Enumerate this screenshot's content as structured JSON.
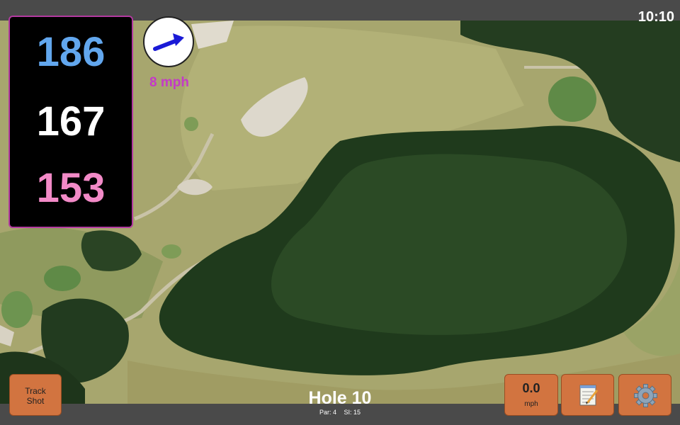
{
  "clock": "10:10",
  "distances": {
    "back": "186",
    "middle": "167",
    "front": "153"
  },
  "wind": {
    "speed": "8 mph",
    "icon": "arrow-right-icon"
  },
  "hole": {
    "title": "Hole 10",
    "par": "Par: 4",
    "si": "SI: 15"
  },
  "buttons": {
    "track_line1": "Track",
    "track_line2": "Shot",
    "speed_value": "0.0",
    "speed_unit": "mph",
    "notes_icon": "notepad-icon",
    "settings_icon": "gear-icon"
  },
  "colors": {
    "back": "#62a7ee",
    "middle": "#ffffff",
    "front": "#f28ac7",
    "panel_border": "#b33aa0",
    "button": "#d27440",
    "wind_text": "#c43ac7"
  }
}
